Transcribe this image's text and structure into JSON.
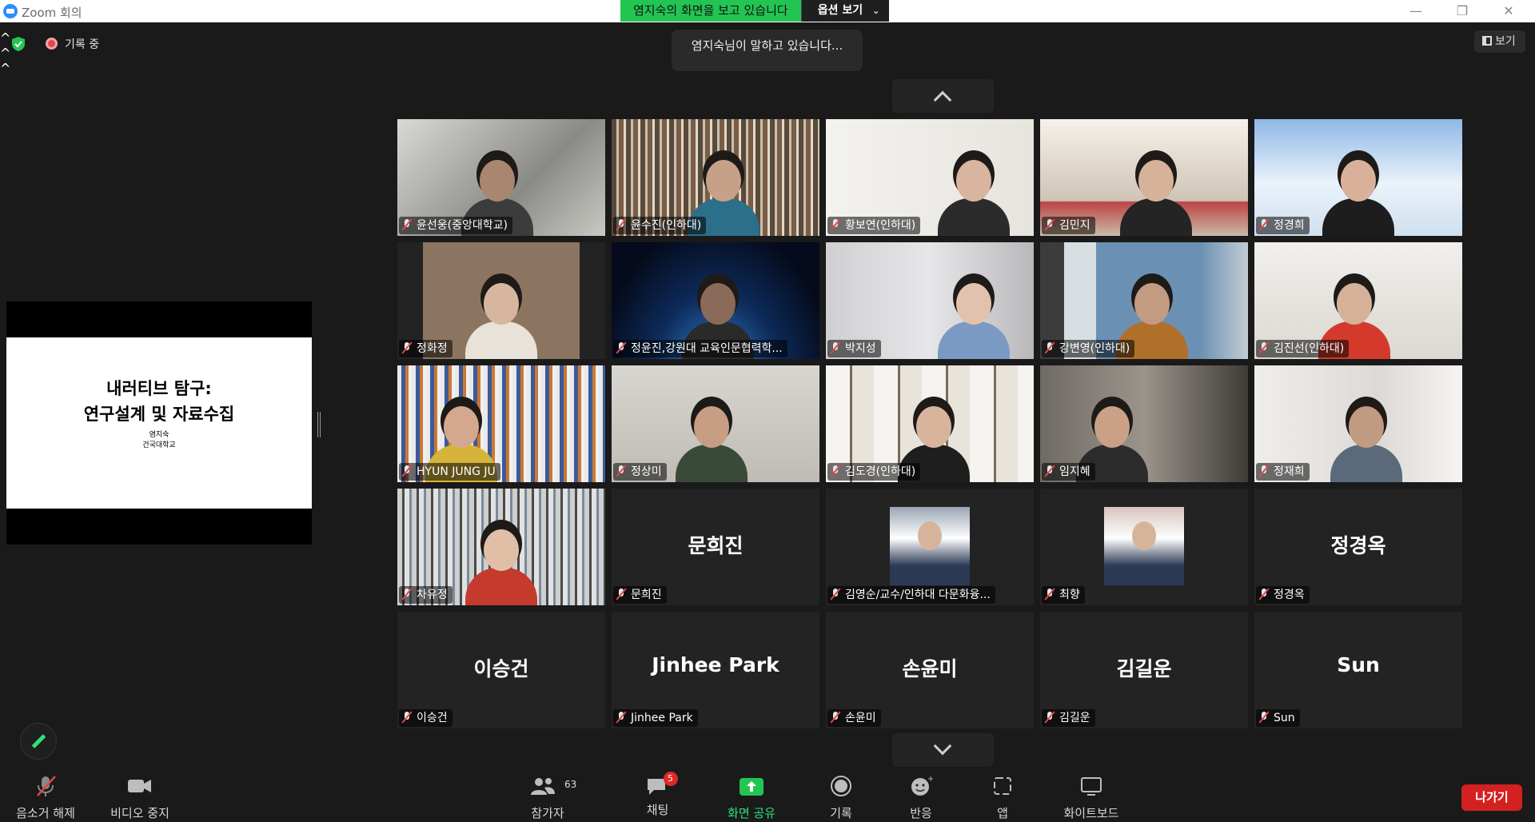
{
  "window": {
    "title": "Zoom 회의"
  },
  "share_banner": {
    "text": "염지숙의 화면을 보고 있습니다",
    "options_label": "옵션 보기"
  },
  "status": {
    "recording_label": "기록 중",
    "view_label": "보기"
  },
  "speaking_toast": "염지숙님이 말하고 있습니다...",
  "shared_slide": {
    "title_line1": "내러티브 탐구:",
    "title_line2": "연구설계 및 자료수집",
    "presenter": "염지숙",
    "affiliation": "건국대학교"
  },
  "participants": [
    {
      "name": "윤선웅(중앙대학교)"
    },
    {
      "name": "윤수진(인하대)"
    },
    {
      "name": "황보연(인하대)"
    },
    {
      "name": "김민지"
    },
    {
      "name": "정경희"
    },
    {
      "name": "정화정"
    },
    {
      "name": "정윤진,강원대 교육인문협력학..."
    },
    {
      "name": "박지성"
    },
    {
      "name": "강변영(인하대)"
    },
    {
      "name": "김진선(인하대)"
    },
    {
      "name": "HYUN JUNG JU"
    },
    {
      "name": "정상미"
    },
    {
      "name": "김도경(인하대)"
    },
    {
      "name": "임지혜"
    },
    {
      "name": "정재희"
    },
    {
      "name": "차유정"
    },
    {
      "name": "문희진",
      "display": "문희진"
    },
    {
      "name": "김영순/교수/인하대 다문화융..."
    },
    {
      "name": "최향"
    },
    {
      "name": "정경옥",
      "display": "정경옥"
    },
    {
      "name": "이승건",
      "display": "이승건"
    },
    {
      "name": "Jinhee Park",
      "display": "Jinhee Park"
    },
    {
      "name": "손윤미",
      "display": "손윤미"
    },
    {
      "name": "김길운",
      "display": "김길운"
    },
    {
      "name": "Sun",
      "display": "Sun"
    }
  ],
  "toolbar": {
    "unmute": "음소거 해제",
    "stop_video": "비디오 중지",
    "participants": "참가자",
    "participants_count": "63",
    "chat": "채팅",
    "chat_badge": "5",
    "share_screen": "화면 공유",
    "record": "기록",
    "reactions": "반응",
    "apps": "앱",
    "whiteboard": "화이트보드",
    "leave": "나가기"
  },
  "colors": {
    "accent_green": "#23c552",
    "leave_red": "#d32121",
    "share_green": "#2ee27a"
  }
}
